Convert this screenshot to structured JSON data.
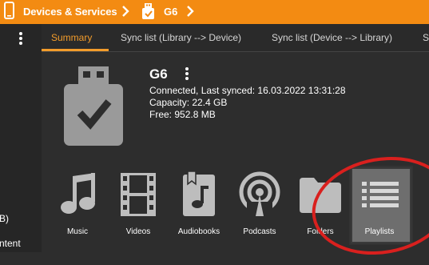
{
  "header": {
    "breadcrumb_root": "Devices & Services",
    "breadcrumb_device": "G6",
    "icons": [
      "phone-icon",
      "chevron-right-icon",
      "usb-icon"
    ],
    "accent_color": "#f38b12"
  },
  "sidebar": {
    "items": [
      {
        "label": "B)"
      },
      {
        "label": "ntent"
      }
    ]
  },
  "tabs": [
    {
      "label": "Summary",
      "active": true
    },
    {
      "label": "Sync list (Library --> Device)",
      "active": false
    },
    {
      "label": "Sync list (Device --> Library)",
      "active": false
    },
    {
      "label": "S",
      "active": false
    }
  ],
  "device": {
    "name": "G6",
    "status": "Connected, Last synced: 16.03.2022 13:31:28",
    "capacity": "Capacity: 22.4 GB",
    "free": "Free: 952.8 MB"
  },
  "categories": [
    {
      "label": "Music",
      "icon": "music-note-icon"
    },
    {
      "label": "Videos",
      "icon": "film-icon"
    },
    {
      "label": "Audiobooks",
      "icon": "audiobook-icon"
    },
    {
      "label": "Podcasts",
      "icon": "podcast-icon"
    },
    {
      "label": "Folders",
      "icon": "folder-icon"
    },
    {
      "label": "Playlists",
      "icon": "playlist-icon",
      "selected": true
    }
  ],
  "annotation_color": "#d9201e"
}
